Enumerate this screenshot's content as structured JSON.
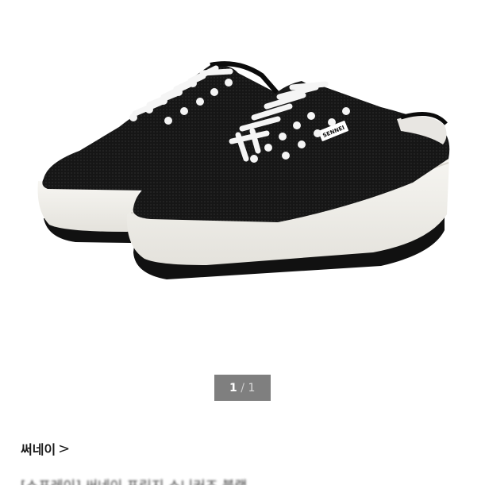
{
  "product": {
    "image_alt": "SENNEI black mesh mule sneakers",
    "shoe_tag": "SENNEI"
  },
  "pager": {
    "current": "1",
    "separator": "/",
    "total": "1"
  },
  "brand": {
    "name": "써네이",
    "chevron": ">"
  },
  "title": {
    "text": "[스프레이] 써네이 프린지 스니커즈 블랙"
  },
  "colors": {
    "shoe_upper": "#141414",
    "sole_white": "#f3f1ec",
    "sole_black": "#111111",
    "laces": "#f5f5f5",
    "pager_bg": "#7f7f7f"
  }
}
